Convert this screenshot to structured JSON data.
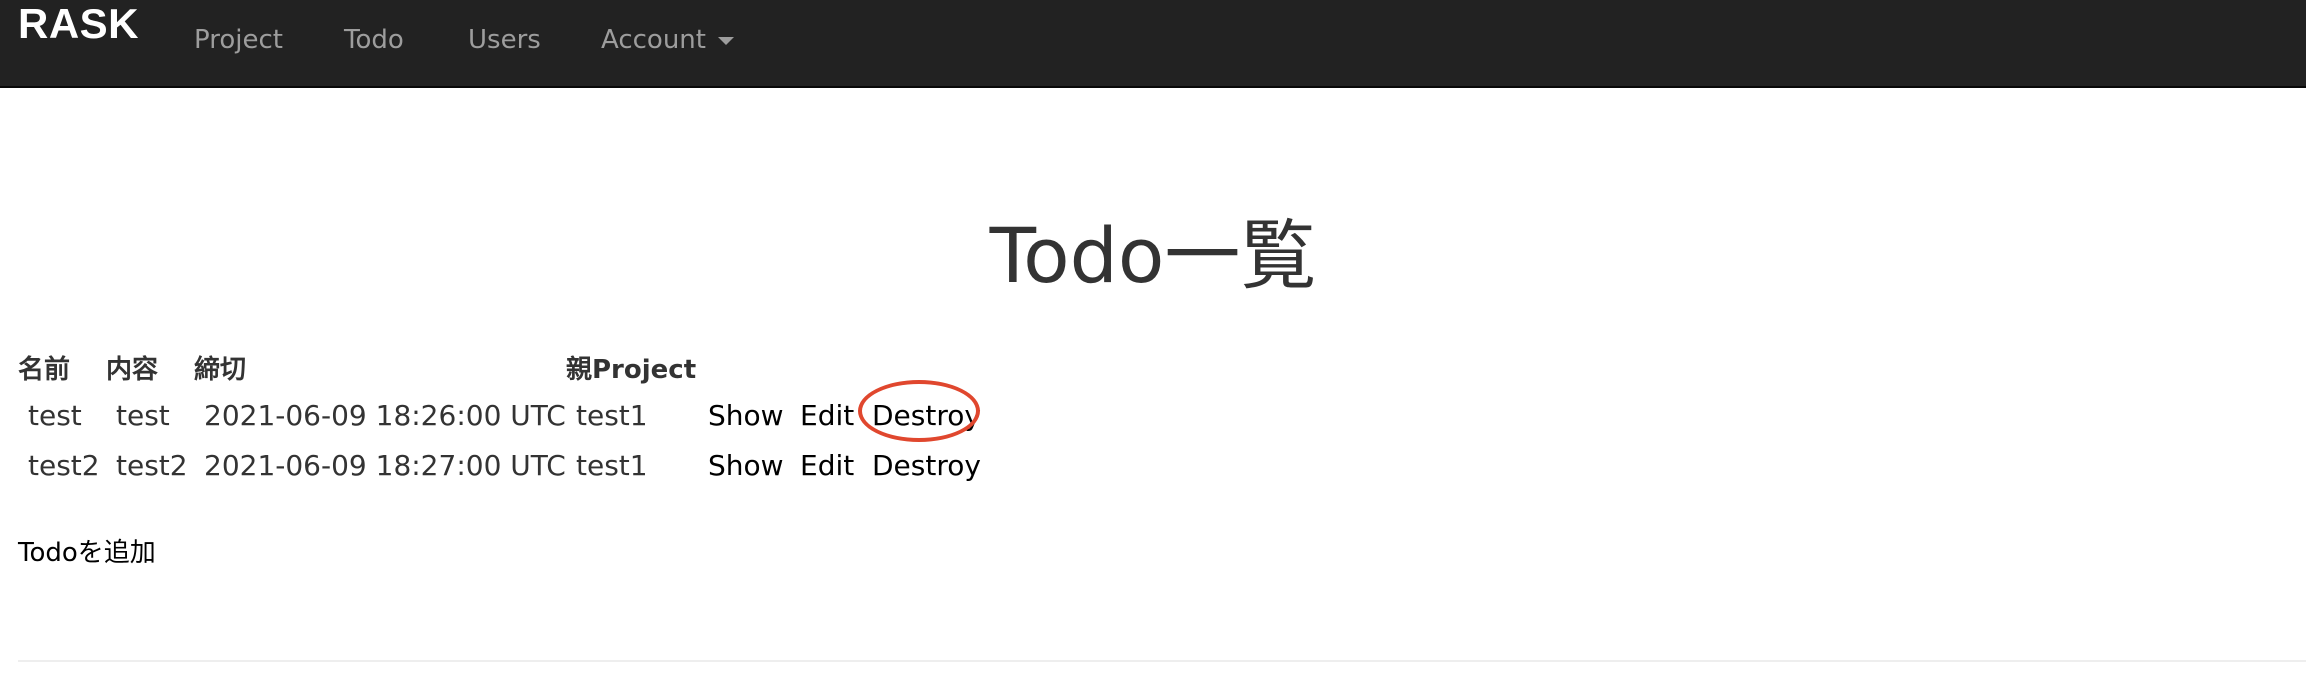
{
  "navbar": {
    "brand": "RASK",
    "items": [
      {
        "label": "Project"
      },
      {
        "label": "Todo"
      },
      {
        "label": "Users"
      },
      {
        "label": "Account"
      }
    ]
  },
  "page": {
    "title": "Todo一覧"
  },
  "table": {
    "headers": [
      "名前",
      "内容",
      "締切",
      "親Project"
    ],
    "rows": [
      {
        "name": "test",
        "content": "test",
        "deadline": "2021-06-09 18:26:00 UTC",
        "project": "test1",
        "show_label": "Show",
        "edit_label": "Edit",
        "destroy_label": "Destroy"
      },
      {
        "name": "test2",
        "content": "test2",
        "deadline": "2021-06-09 18:27:00 UTC",
        "project": "test1",
        "show_label": "Show",
        "edit_label": "Edit",
        "destroy_label": "Destroy"
      }
    ]
  },
  "add_todo_label": "Todoを追加",
  "colors": {
    "navbar_bg": "#222222",
    "nav_text": "#9d9d9d",
    "brand_text": "#ffffff",
    "highlight_ring": "#e0472e"
  }
}
